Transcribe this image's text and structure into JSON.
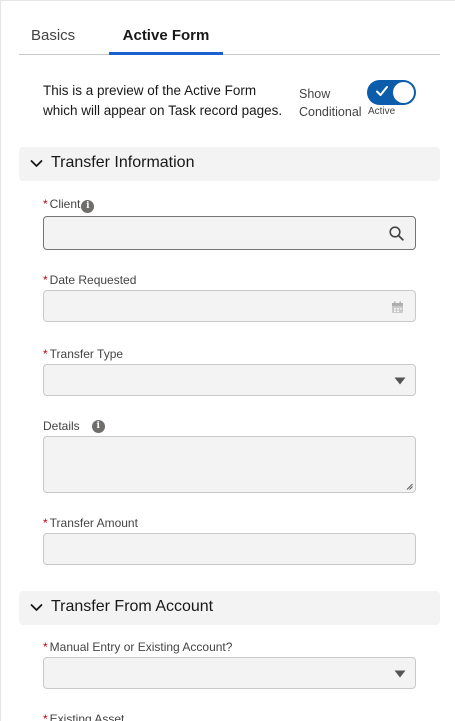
{
  "tabs": {
    "basics": "Basics",
    "active_form": "Active Form"
  },
  "intro": {
    "text": "This is a preview of the Active Form which will appear on Task record pages.",
    "show_conditional": "Show Conditional",
    "toggle_label": "Active",
    "toggle_on": true
  },
  "sections": {
    "transfer_info": "Transfer Information",
    "transfer_from": "Transfer From Account"
  },
  "fields": {
    "client": "Client",
    "date_requested": "Date Requested",
    "transfer_type": "Transfer Type",
    "details": "Details",
    "transfer_amount": "Transfer Amount",
    "manual_entry": "Manual Entry or Existing Account?",
    "existing_asset": "Existing Asset"
  },
  "required_mark": "*",
  "info_glyph": "i",
  "colors": {
    "accent": "#0b5cab",
    "tab_underline": "#1b5fd0",
    "required": "#ba0517"
  }
}
